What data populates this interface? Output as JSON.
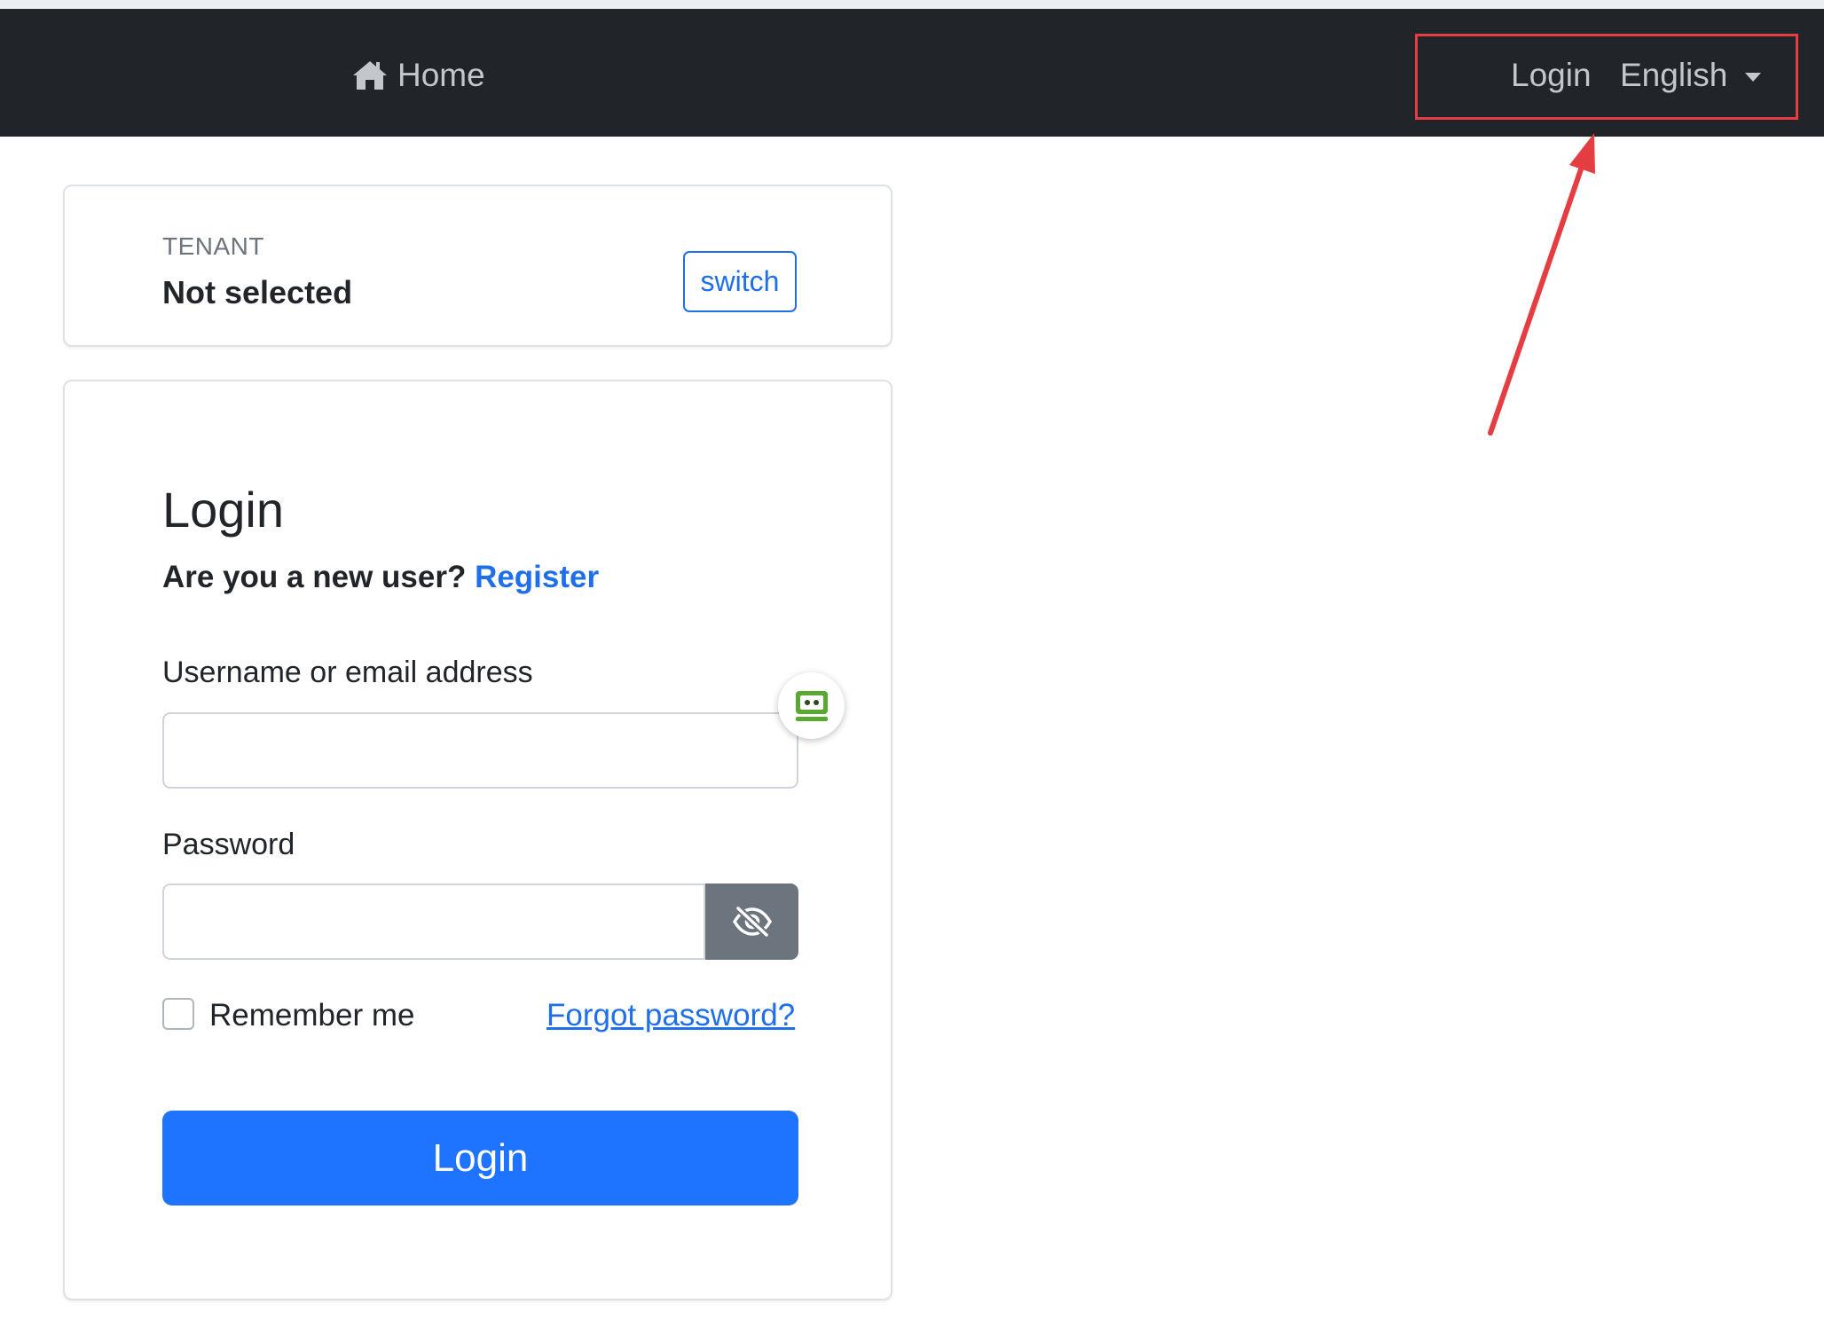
{
  "navbar": {
    "home_label": "Home",
    "login_label": "Login",
    "language_label": "English"
  },
  "tenant": {
    "label": "TENANT",
    "value": "Not selected",
    "switch_label": "switch"
  },
  "login_form": {
    "title": "Login",
    "new_user_prompt": "Are you a new user?",
    "register_label": "Register",
    "username_label": "Username or email address",
    "username_value": "",
    "password_label": "Password",
    "password_value": "",
    "remember_label": "Remember me",
    "remember_checked": false,
    "forgot_label": "Forgot password?",
    "submit_label": "Login"
  },
  "colors": {
    "navbar_bg": "#212529",
    "primary": "#1f74ff",
    "link": "#1f6feb",
    "annotation": "#e53e42"
  },
  "icons": {
    "home": "home-icon",
    "eye": "eye-slash-icon",
    "password_manager": "roboform-icon"
  }
}
